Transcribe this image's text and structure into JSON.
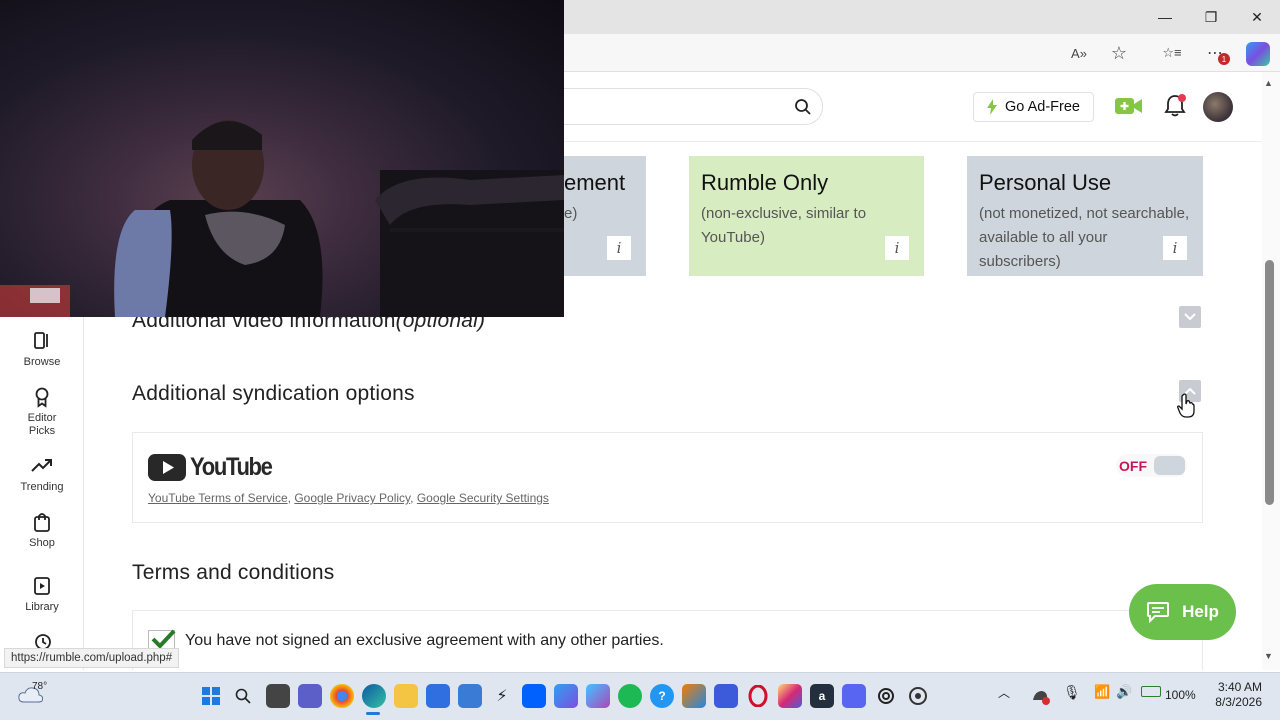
{
  "browser": {
    "window_controls": {
      "minimize": "—",
      "restore": "❐",
      "close": "✕"
    },
    "toolbar": {
      "read_aloud": "A»",
      "favorite": "☆",
      "favorites": "☆≡",
      "more": "⋯",
      "badge": "1"
    }
  },
  "header": {
    "go_ad_free": "Go Ad-Free",
    "notification_dot": true
  },
  "sidebar": {
    "items": [
      {
        "label": "Browse",
        "icon": "browse-icon"
      },
      {
        "label": "Editor Picks",
        "icon": "ribbon-icon"
      },
      {
        "label": "Trending",
        "icon": "trending-icon"
      },
      {
        "label": "Shop",
        "icon": "shop-icon"
      },
      {
        "label": "Library",
        "icon": "library-icon"
      }
    ]
  },
  "licensing": {
    "partial_card": {
      "title": "ement",
      "desc": "e)"
    },
    "rumble_only": {
      "title": "Rumble Only",
      "desc": "(non-exclusive, similar to YouTube)",
      "color": "#d8ecc2"
    },
    "personal_use": {
      "title": "Personal Use",
      "desc": "(not monetized, not searchable, available to all your subscribers)",
      "color": "#cfd5dc"
    },
    "info_glyph": "i"
  },
  "sections": {
    "additional_info": {
      "title": "Additional video information",
      "optional": "(optional)"
    },
    "syndication": {
      "title": "Additional syndication options"
    },
    "terms": {
      "title": "Terms and conditions"
    }
  },
  "youtube": {
    "logo_text": "YouTube",
    "links": [
      "YouTube Terms of Service",
      "Google Privacy Policy",
      "Google Security Settings"
    ],
    "separator": ",",
    "toggle_state": "OFF"
  },
  "terms": {
    "checkbox_label": "You have not signed an exclusive agreement with any other parties.",
    "checked": true
  },
  "help": {
    "label": "Help"
  },
  "status_url": "https://rumble.com/upload.php#",
  "taskbar": {
    "weather": "78°",
    "battery": "100%",
    "time": "3:40 AM",
    "date": "8/3/2026"
  },
  "colors": {
    "rumble_green": "#85c742",
    "off_red": "#c2185b",
    "youtube_red": "#ff0000"
  }
}
